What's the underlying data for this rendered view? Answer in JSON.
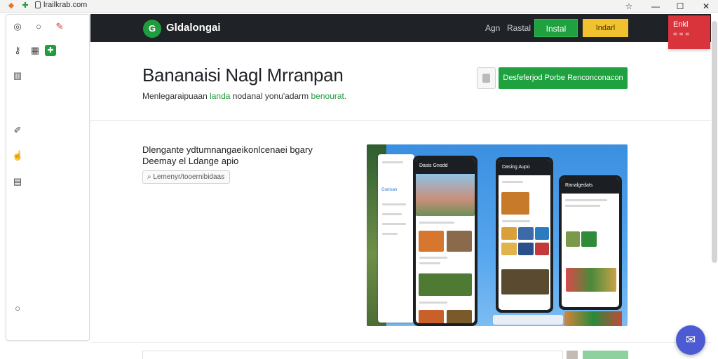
{
  "browser": {
    "url": "lrailkrab.com",
    "minimize_glyph": "—",
    "maximize_glyph": "☐",
    "close_glyph": "✕",
    "star_glyph": "☆"
  },
  "topnav": {
    "brand": "Gldalongai",
    "logo_glyph": "G",
    "links": [
      "Agn",
      "Rastal"
    ],
    "install_label": "Instal",
    "secondary_label": "Indarl"
  },
  "red_badge": {
    "title": "Enkl",
    "subtitle": "= = ="
  },
  "hero": {
    "title": "Bananaisi Nagl Mrranpan",
    "subtitle_prefix": "Menlegaraipuaan ",
    "subtitle_green1": "landa",
    "subtitle_mid": " nodanal yonu'adarm ",
    "subtitle_green2": "benourat.",
    "cta_label": "Desfeferjod Porbe Renconconacon"
  },
  "section": {
    "text_line1": "Dlengante ydtumnangaeikonlcenaei bgary",
    "text_line2": "Deemay el Ldange apio",
    "chip_label": "Lemenyr/tooernibidaas"
  },
  "screenshot": {
    "phone1_header": "Dasis Gnodd",
    "phone2_header": "Dasing Aupo",
    "phone3_header": "Ranalgedats",
    "sidebar_link": "Gonisan"
  },
  "icons": {
    "sidebar": [
      "globe-icon",
      "search-icon",
      "pin-icon",
      "key-icon",
      "grid-icon",
      "app-icon",
      "table-icon",
      "pencil-icon",
      "hand-icon",
      "document-icon",
      "circle-icon"
    ],
    "chat": "chat-icon"
  },
  "colors": {
    "accent_green": "#1ea13e",
    "nav_dark": "#1f2226",
    "yellow": "#f2c12e",
    "badge_red": "#d9333b",
    "chat_blue": "#4c5bd4"
  }
}
